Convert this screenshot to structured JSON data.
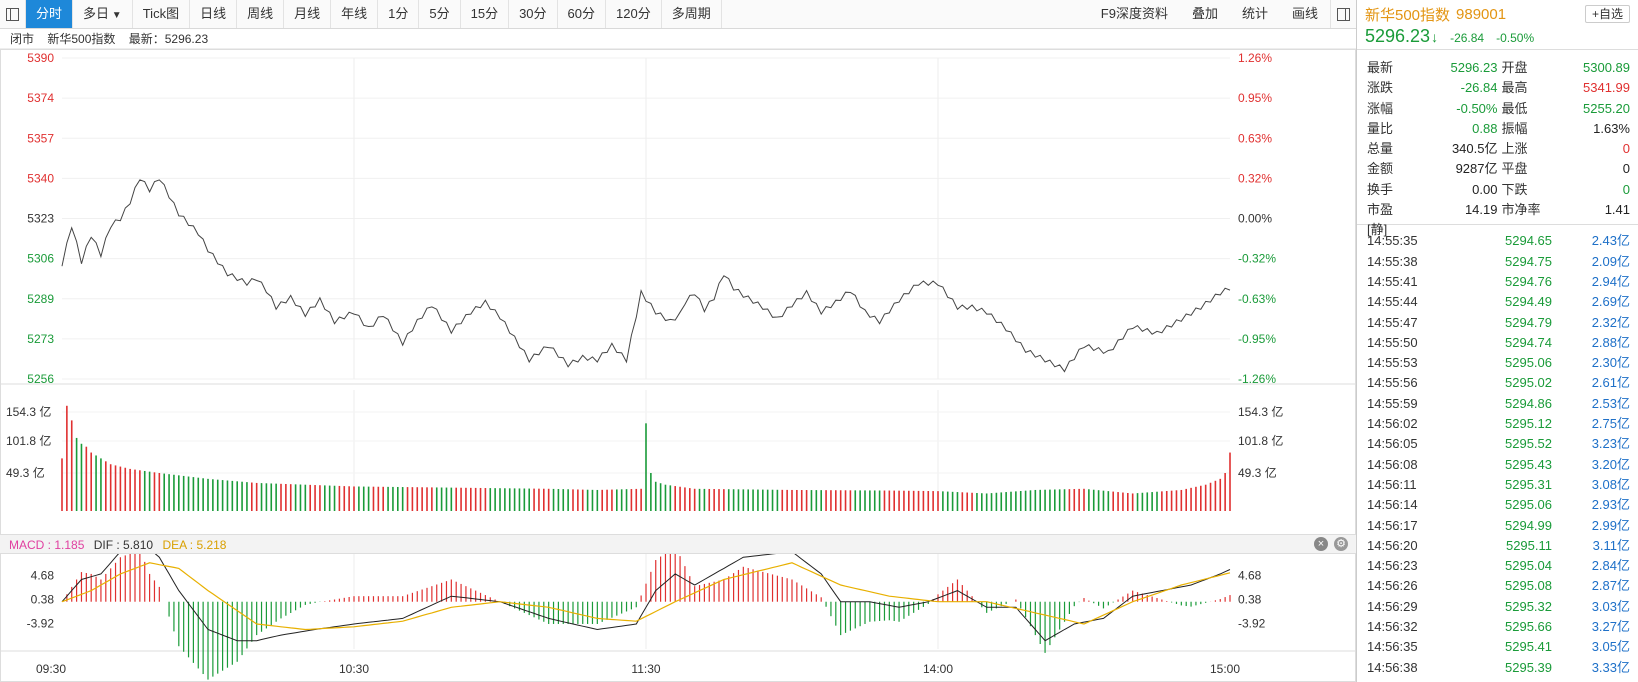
{
  "toolbar": {
    "tabs": [
      "分时",
      "多日",
      "Tick图",
      "日线",
      "周线",
      "月线",
      "年线",
      "1分",
      "5分",
      "15分",
      "30分",
      "60分",
      "120分",
      "多周期"
    ],
    "active": 0,
    "multiday_arrow": "▼",
    "right": [
      "F9深度资料",
      "叠加",
      "统计",
      "画线"
    ]
  },
  "infostrip": {
    "status": "闭市",
    "name": "新华500指数",
    "latest": "最新：5296.23"
  },
  "colors": {
    "up": "#e03030",
    "down": "#1a9b39",
    "line": "#444444",
    "dea": "#e8b000",
    "accent": "#1e88d9",
    "macd_label": "#e040a0"
  },
  "axis": {
    "price_labels": [
      "5390",
      "5374",
      "5357",
      "5340",
      "5323",
      "5306",
      "5289",
      "5273",
      "5256"
    ],
    "pct_labels": [
      "1.26%",
      "0.95%",
      "0.63%",
      "0.32%",
      "0.00%",
      "-0.32%",
      "-0.63%",
      "-0.95%",
      "-1.26%"
    ],
    "vol_labels": [
      "154.3 亿",
      "101.8 亿",
      "49.3 亿"
    ],
    "macd_labels": [
      "4.68",
      "0.38",
      "-3.92"
    ],
    "time_labels": [
      "09:30",
      "10:30",
      "11:30",
      "14:00",
      "15:00"
    ]
  },
  "macd_header": {
    "macd": "MACD : 1.185",
    "dif": "DIF : 5.810",
    "dea": "DEA : 5.218",
    "close_icon": "close-icon",
    "gear_icon": "gear-icon"
  },
  "chart_data": {
    "type": "line",
    "price": {
      "min": 5256,
      "max": 5390,
      "prev_close": 5323,
      "knots_t": [
        0,
        2,
        4,
        6,
        8,
        10,
        12,
        14,
        16,
        18,
        20,
        24,
        28,
        30,
        32,
        34,
        36,
        38,
        40,
        42,
        44,
        47,
        50,
        53,
        56,
        60,
        63,
        66,
        70,
        73,
        76,
        80,
        84,
        87,
        90,
        93,
        96,
        100,
        104,
        107,
        110,
        113,
        116,
        119,
        122,
        125,
        127,
        128,
        130,
        132,
        134,
        136,
        138,
        140,
        144,
        147,
        150,
        153,
        156,
        159,
        162,
        165,
        168,
        172,
        176,
        180,
        184,
        187,
        190,
        194,
        198,
        202,
        206,
        210,
        215,
        220,
        225,
        230,
        234,
        238,
        240
      ],
      "knots_v": [
        5304,
        5320,
        5305,
        5316,
        5308,
        5320,
        5323,
        5330,
        5340,
        5335,
        5340,
        5325,
        5317,
        5310,
        5305,
        5300,
        5298,
        5296,
        5298,
        5293,
        5286,
        5290,
        5283,
        5289,
        5280,
        5284,
        5277,
        5283,
        5271,
        5280,
        5287,
        5276,
        5284,
        5288,
        5282,
        5273,
        5264,
        5270,
        5262,
        5265,
        5264,
        5270,
        5264,
        5292,
        5284,
        5280,
        5283,
        5288,
        5292,
        5285,
        5290,
        5300,
        5294,
        5291,
        5286,
        5281,
        5287,
        5292,
        5284,
        5288,
        5293,
        5284,
        5280,
        5289,
        5296,
        5296,
        5286,
        5286,
        5284,
        5277,
        5268,
        5264,
        5260,
        5270,
        5267,
        5278,
        5275,
        5281,
        5286,
        5292,
        5294
      ],
      "n": 241
    },
    "volume": {
      "max": 207.0,
      "knots_t": [
        0,
        1,
        2,
        3,
        4,
        5,
        6,
        8,
        10,
        14,
        20,
        30,
        40,
        60,
        80,
        100,
        110,
        119,
        120,
        121,
        122,
        124,
        130,
        150,
        170,
        180,
        190,
        200,
        210,
        220,
        230,
        235,
        238,
        239,
        240
      ],
      "knots_v": [
        90,
        180,
        155,
        125,
        115,
        110,
        100,
        90,
        80,
        72,
        65,
        55,
        48,
        42,
        40,
        38,
        36,
        38,
        150,
        65,
        50,
        45,
        38,
        36,
        35,
        34,
        30,
        36,
        38,
        30,
        36,
        45,
        55,
        65,
        100
      ],
      "n": 241
    },
    "macd": {
      "min": -8.5,
      "max": 12.0,
      "dif_t": [
        0,
        4,
        8,
        12,
        16,
        20,
        24,
        30,
        36,
        40,
        45,
        52,
        60,
        70,
        80,
        90,
        100,
        110,
        118,
        122,
        126,
        130,
        140,
        150,
        156,
        160,
        166,
        172,
        178,
        184,
        190,
        196,
        202,
        208,
        214,
        220,
        226,
        232,
        238,
        240
      ],
      "dif_v": [
        0,
        4,
        5,
        9,
        11,
        8,
        2,
        -5,
        -7,
        -7,
        -6,
        -5,
        -4,
        -3,
        1,
        0,
        -3,
        -5,
        -4,
        2,
        5,
        3,
        8,
        9,
        5,
        0,
        0,
        -1,
        0,
        2,
        -1,
        -1,
        -7,
        -4,
        -3,
        1,
        2,
        3,
        5,
        5.8
      ],
      "dea_t": [
        0,
        6,
        12,
        18,
        24,
        30,
        40,
        50,
        60,
        70,
        80,
        90,
        100,
        110,
        118,
        126,
        136,
        150,
        160,
        170,
        180,
        190,
        200,
        210,
        220,
        230,
        240
      ],
      "dea_v": [
        0,
        2,
        5,
        7,
        6,
        2,
        -4,
        -5,
        -4.5,
        -3.5,
        -1,
        0,
        -1,
        -3,
        -3.5,
        0,
        4,
        7,
        3,
        1,
        0,
        0,
        -2,
        -4,
        0,
        3,
        5.2
      ],
      "n": 241
    }
  },
  "side": {
    "name": "新华500指数",
    "code": "989001",
    "fav": "+自选",
    "price": "5296.23",
    "arrow": "↓",
    "change": "-26.84",
    "pct": "-0.50%",
    "quote": [
      {
        "l1": "最新",
        "v1": "5296.23",
        "c1": "g",
        "l2": "开盘",
        "v2": "5300.89",
        "c2": "g"
      },
      {
        "l1": "涨跌",
        "v1": "-26.84",
        "c1": "g",
        "l2": "最高",
        "v2": "5341.99",
        "c2": "r"
      },
      {
        "l1": "涨幅",
        "v1": "-0.50%",
        "c1": "g",
        "l2": "最低",
        "v2": "5255.20",
        "c2": "g"
      },
      {
        "l1": "量比",
        "v1": "0.88",
        "c1": "g",
        "l2": "振幅",
        "v2": "1.63%",
        "c2": "k"
      },
      {
        "l1": "总量",
        "v1": "340.5亿",
        "c1": "k",
        "l2": "上涨",
        "v2": "0",
        "c2": "r"
      },
      {
        "l1": "金额",
        "v1": "9287亿",
        "c1": "k",
        "l2": "平盘",
        "v2": "0",
        "c2": "k"
      },
      {
        "l1": "换手",
        "v1": "0.00",
        "c1": "k",
        "l2": "下跌",
        "v2": "0",
        "c2": "g"
      },
      {
        "l1": "市盈[静]",
        "v1": "14.19",
        "c1": "k",
        "l2": "市净率",
        "v2": "1.41",
        "c2": "k"
      }
    ],
    "ticks": [
      {
        "time": "14:55:35",
        "price": "5294.65",
        "vol": "2.43亿"
      },
      {
        "time": "14:55:38",
        "price": "5294.75",
        "vol": "2.09亿"
      },
      {
        "time": "14:55:41",
        "price": "5294.76",
        "vol": "2.94亿"
      },
      {
        "time": "14:55:44",
        "price": "5294.49",
        "vol": "2.69亿"
      },
      {
        "time": "14:55:47",
        "price": "5294.79",
        "vol": "2.32亿"
      },
      {
        "time": "14:55:50",
        "price": "5294.74",
        "vol": "2.88亿"
      },
      {
        "time": "14:55:53",
        "price": "5295.06",
        "vol": "2.30亿"
      },
      {
        "time": "14:55:56",
        "price": "5295.02",
        "vol": "2.61亿"
      },
      {
        "time": "14:55:59",
        "price": "5294.86",
        "vol": "2.53亿"
      },
      {
        "time": "14:56:02",
        "price": "5295.12",
        "vol": "2.75亿"
      },
      {
        "time": "14:56:05",
        "price": "5295.52",
        "vol": "3.23亿"
      },
      {
        "time": "14:56:08",
        "price": "5295.43",
        "vol": "3.20亿"
      },
      {
        "time": "14:56:11",
        "price": "5295.31",
        "vol": "3.08亿"
      },
      {
        "time": "14:56:14",
        "price": "5295.06",
        "vol": "2.93亿"
      },
      {
        "time": "14:56:17",
        "price": "5294.99",
        "vol": "2.99亿"
      },
      {
        "time": "14:56:20",
        "price": "5295.11",
        "vol": "3.11亿"
      },
      {
        "time": "14:56:23",
        "price": "5295.04",
        "vol": "2.84亿"
      },
      {
        "time": "14:56:26",
        "price": "5295.08",
        "vol": "2.87亿"
      },
      {
        "time": "14:56:29",
        "price": "5295.32",
        "vol": "3.03亿"
      },
      {
        "time": "14:56:32",
        "price": "5295.66",
        "vol": "3.27亿"
      },
      {
        "time": "14:56:35",
        "price": "5295.41",
        "vol": "3.05亿"
      },
      {
        "time": "14:56:38",
        "price": "5295.39",
        "vol": "3.33亿"
      }
    ]
  }
}
